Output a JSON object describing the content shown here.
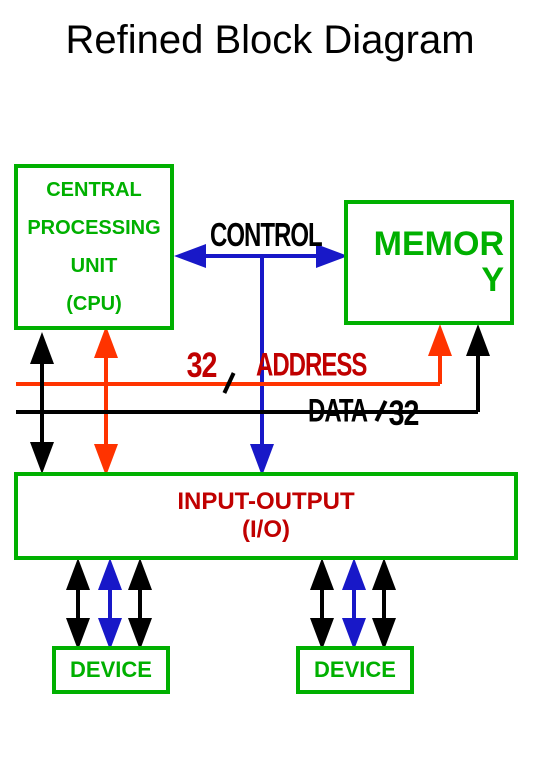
{
  "title": "Refined Block Diagram",
  "blocks": {
    "cpu_l1": "CENTRAL",
    "cpu_l2": "PROCESSING",
    "cpu_l3": "UNIT",
    "cpu_l4": "(CPU)",
    "mem_l1": "MEMOR",
    "mem_l2": "Y",
    "io_l1": "INPUT-OUTPUT",
    "io_l2": "(I/O)",
    "device": "DEVICE"
  },
  "labels": {
    "control": "CONTROL",
    "address": "ADDRESS",
    "data": "DATA",
    "bus_width": "32"
  },
  "chart_data": {
    "type": "block-diagram",
    "title": "Refined Block Diagram",
    "nodes": [
      {
        "id": "cpu",
        "label": "CENTRAL PROCESSING UNIT (CPU)"
      },
      {
        "id": "memory",
        "label": "MEMORY"
      },
      {
        "id": "io",
        "label": "INPUT-OUTPUT (I/O)"
      },
      {
        "id": "device1",
        "label": "DEVICE"
      },
      {
        "id": "device2",
        "label": "DEVICE"
      }
    ],
    "buses": [
      {
        "name": "CONTROL",
        "color": "blue",
        "connects": [
          "cpu",
          "memory",
          "io",
          "device1",
          "device2"
        ]
      },
      {
        "name": "ADDRESS",
        "color": "red",
        "width": 32,
        "connects": [
          "cpu",
          "memory",
          "io"
        ]
      },
      {
        "name": "DATA",
        "color": "black",
        "width": 32,
        "connects": [
          "cpu",
          "memory",
          "io",
          "device1",
          "device2"
        ]
      }
    ]
  }
}
